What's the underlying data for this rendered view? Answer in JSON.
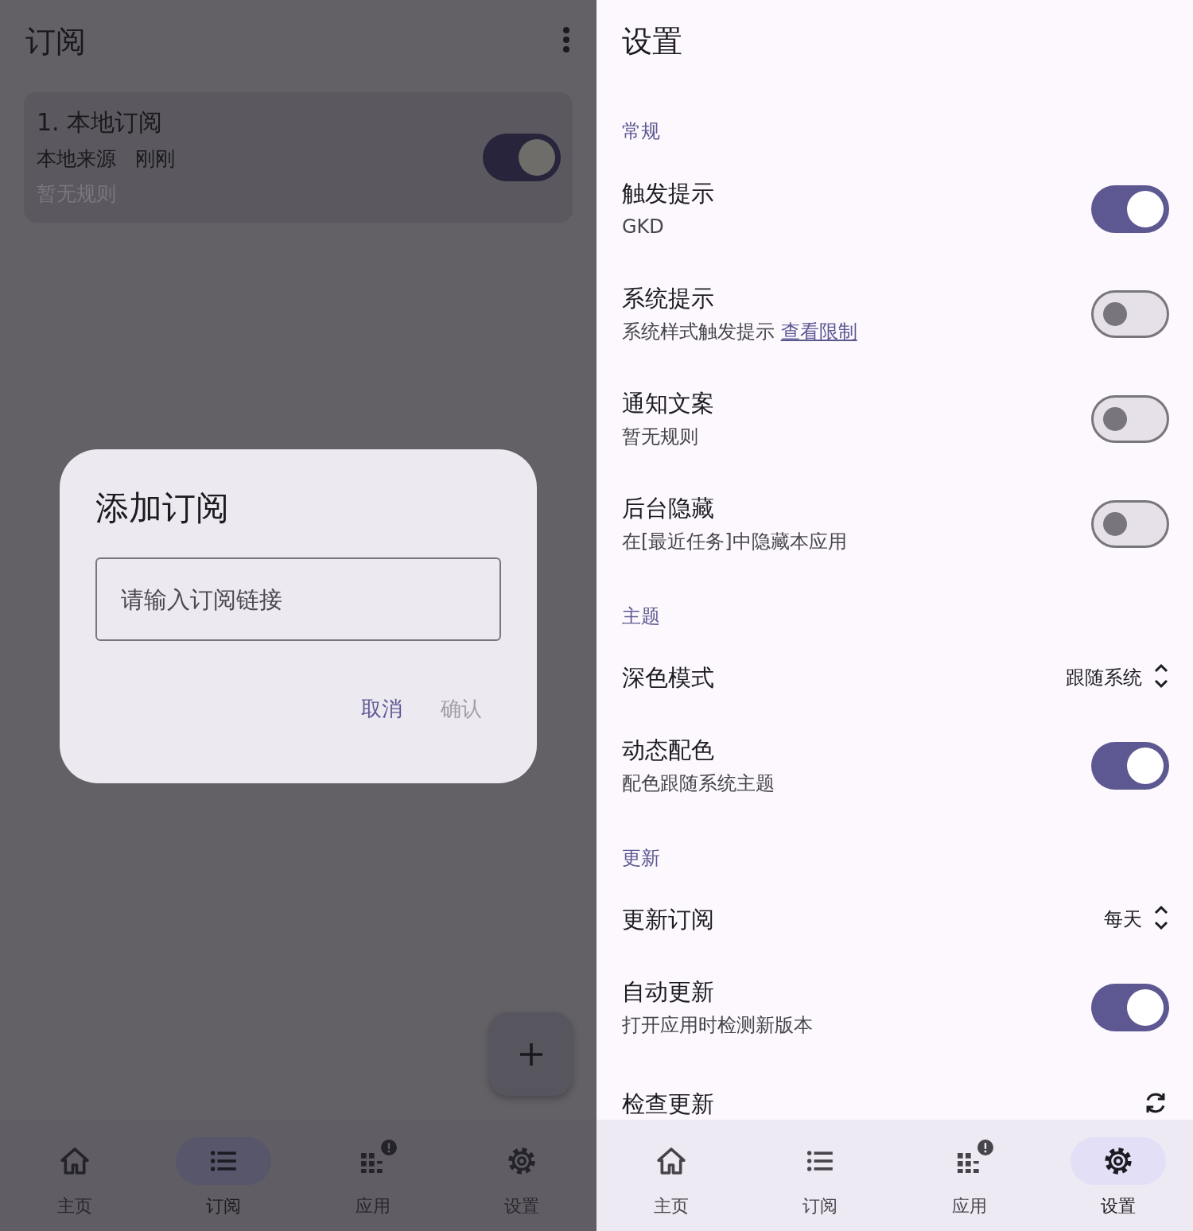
{
  "subscriptions_screen": {
    "title": "订阅",
    "subscriptions": [
      {
        "name": "1. 本地订阅",
        "source": "本地来源",
        "time": "刚刚",
        "rules": "暂无规则",
        "on": true
      }
    ],
    "dialog": {
      "title": "添加订阅",
      "input": {
        "placeholder": "请输入订阅链接"
      },
      "buttons": [
        {
          "label": "取消",
          "disabled": false
        },
        {
          "label": "确认",
          "disabled": true
        }
      ]
    },
    "nav": [
      {
        "kind": "home",
        "label": "主页",
        "selected": false,
        "badge": false
      },
      {
        "kind": "list",
        "label": "订阅",
        "selected": true,
        "badge": false
      },
      {
        "kind": "apps",
        "label": "应用",
        "selected": false,
        "badge": true
      },
      {
        "kind": "settings",
        "label": "设置",
        "selected": false,
        "badge": false
      }
    ]
  },
  "settings_screen": {
    "title": "设置",
    "sections": [
      {
        "title": "常规",
        "items": [
          {
            "kind": "switch",
            "title": "触发提示",
            "subtitle": "GKD",
            "on": true
          },
          {
            "kind": "switch",
            "title": "系统提示",
            "subtitle": "系统样式触发提示",
            "link": "查看限制",
            "on": false
          },
          {
            "kind": "switch",
            "title": "通知文案",
            "subtitle": "暂无规则",
            "on": false
          },
          {
            "kind": "switch",
            "title": "后台隐藏",
            "subtitle": "在[最近任务]中隐藏本应用",
            "on": false
          }
        ]
      },
      {
        "title": "主题",
        "items": [
          {
            "kind": "select",
            "title": "深色模式",
            "value": "跟随系统"
          },
          {
            "kind": "switch",
            "title": "动态配色",
            "subtitle": "配色跟随系统主题",
            "on": true
          }
        ]
      },
      {
        "title": "更新",
        "items": [
          {
            "kind": "select",
            "title": "更新订阅",
            "value": "每天"
          },
          {
            "kind": "switch",
            "title": "自动更新",
            "subtitle": "打开应用时检测新版本",
            "on": true
          },
          {
            "kind": "action",
            "title": "检查更新"
          }
        ]
      }
    ],
    "nav": [
      {
        "kind": "home",
        "label": "主页",
        "selected": false,
        "badge": false
      },
      {
        "kind": "list",
        "label": "订阅",
        "selected": false,
        "badge": false
      },
      {
        "kind": "apps",
        "label": "应用",
        "selected": false,
        "badge": true
      },
      {
        "kind": "settings",
        "label": "设置",
        "selected": true,
        "badge": false
      }
    ]
  }
}
